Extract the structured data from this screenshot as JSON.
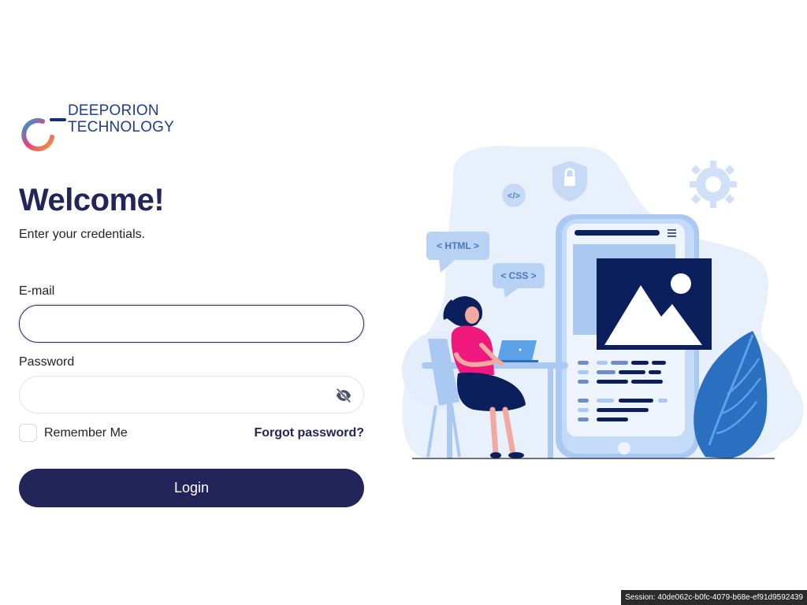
{
  "logo": {
    "line1": "DEEPORION",
    "line2": "TECHNOLOGY"
  },
  "heading": {
    "title": "Welcome!",
    "subtitle": "Enter your credentials."
  },
  "form": {
    "email_label": "E-mail",
    "email_value": "",
    "password_label": "Password",
    "password_value": "",
    "password_toggle_icon": "eye-slash-icon",
    "remember_label": "Remember Me",
    "remember_checked": false,
    "forgot_label": "Forgot password?",
    "login_label": "Login"
  },
  "illustration": {
    "html_tag": "< HTML >",
    "css_tag": "< CSS >",
    "code_tag": "</>"
  },
  "footer": {
    "session_text": "Session: 40de062c-b0fc-4079-b68e-ef91d9592439"
  },
  "colors": {
    "primary": "#23245a",
    "accent_pink": "#f0187d",
    "illustration_blue": "#a9c8f2",
    "illustration_dark": "#0b1f5c"
  }
}
